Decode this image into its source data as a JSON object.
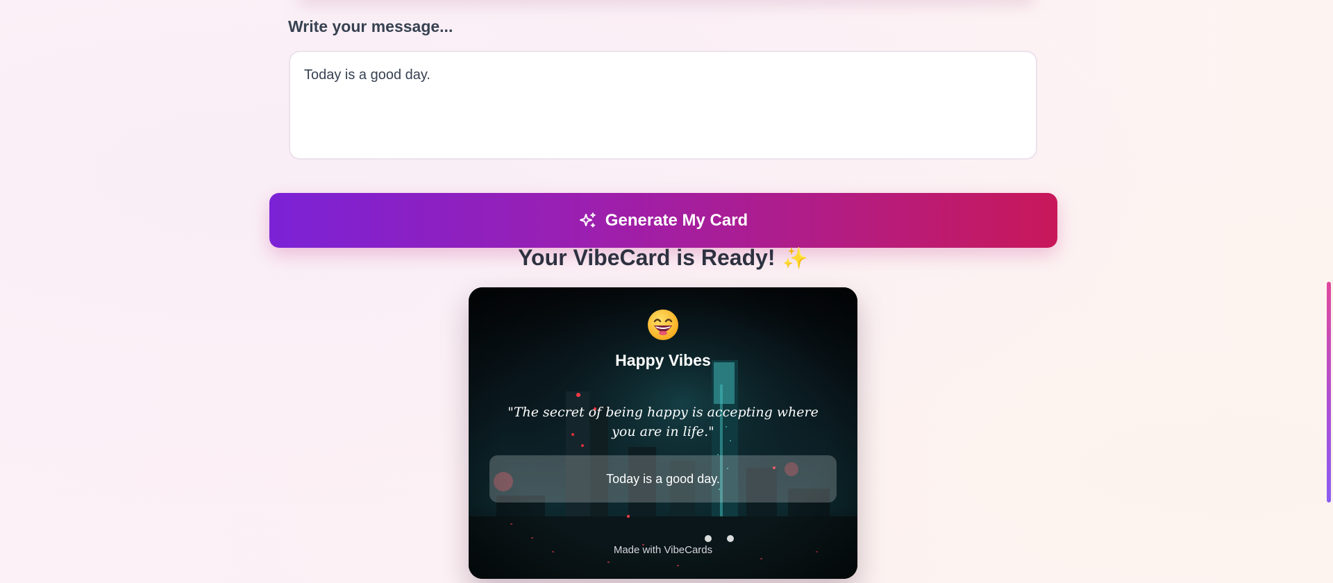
{
  "form": {
    "message_label": "Write your message...",
    "message_value": "Today is a good day.",
    "generate_label": "Generate My Card"
  },
  "result": {
    "title": "Your VibeCard is Ready!",
    "title_emoji": "✨"
  },
  "card": {
    "emoji": "grinning-face",
    "vibe_title": "Happy Vibes",
    "quote": "\"The secret of being happy is accepting where you are in life.\"",
    "message": "Today is a good day.",
    "footer": "Made with VibeCards"
  },
  "scrollbar": {
    "position": 0.52
  },
  "colors": {
    "button_gradient_start": "#7b22d6",
    "button_gradient_end": "#c8185a",
    "text_dark": "#2d3140",
    "card_background": "#04080b",
    "scrollbar_start": "#e0489c",
    "scrollbar_end": "#8a5cf0"
  }
}
